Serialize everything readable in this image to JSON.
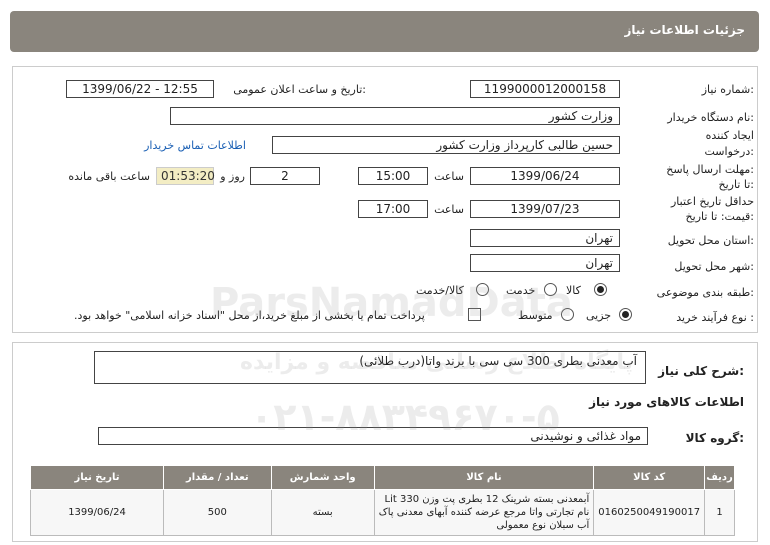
{
  "header": {
    "title": "جزئیات اطلاعات نیاز"
  },
  "form": {
    "need_number_label": "شماره نیاز:",
    "need_number": "1199000012000158",
    "announce_label": "تاریخ و ساعت اعلان عمومی:",
    "announce_value": "1399/06/22 - 12:55",
    "buyer_label": "نام دستگاه خریدار:",
    "buyer_value": "وزارت کشور",
    "requester_label_1": "ایجاد کننده",
    "requester_label_2": "درخواست:",
    "requester_value": "حسین طالبی کارپرداز وزارت کشور",
    "contact_link": "اطلاعات تماس خریدار",
    "deadline_label_1": "مهلت ارسال پاسخ:",
    "deadline_label_2": "تا تاریخ:",
    "deadline_date": "1399/06/24",
    "time_label": "ساعت",
    "deadline_time": "15:00",
    "days_value": "2",
    "days_label": "روز و",
    "remaining_time": "01:53:20",
    "remaining_label": "ساعت باقی مانده",
    "validity_label_1": "حداقل تاریخ اعتبار",
    "validity_label_2": "قیمت: تا تاریخ:",
    "validity_date": "1399/07/23",
    "validity_time_label": "ساعت",
    "validity_time": "17:00",
    "province_label": "استان محل تحویل:",
    "province_value": "تهران",
    "city_label": "شهر محل تحویل:",
    "city_value": "تهران",
    "category_label": "طبقه بندی موضوعی:",
    "category_options": [
      "کالا",
      "خدمت",
      "کالا/خدمت"
    ],
    "category_selected": "کالا",
    "process_label": "نوع فرآیند خرید :",
    "process_options": [
      "جزیی",
      "متوسط"
    ],
    "process_selected": "جزیی",
    "payment_note": "پرداخت تمام یا بخشی از مبلغ خرید،از محل \"اسناد خزانه اسلامی\" خواهد بود."
  },
  "summary": {
    "label": "شرح کلی نیاز:",
    "value": "آب معدنی بطری 300 سی سی با برند واتا(درب طلائی)"
  },
  "goods": {
    "section_title": "اطلاعات کالاهای مورد نیاز",
    "group_label": "گروه کالا:",
    "group_value": "مواد غذائی و نوشیدنی",
    "columns": [
      "ردیف",
      "کد کالا",
      "نام کالا",
      "واحد شمارش",
      "تعداد / مقدار",
      "تاریخ نیاز"
    ],
    "rows": [
      {
        "index": "1",
        "code": "0160250049190017",
        "name": "آبمعدنی بسته شرینک 12 بطری پت وزن Lit 330 نام تجارتی واتا مرجع عرضه کننده آبهای معدنی پاک آب سبلان نوع معمولی",
        "unit": "بسته",
        "qty": "500",
        "date": "1399/06/24"
      }
    ]
  },
  "watermark": {
    "line1": "ParsNamadData",
    "line2": "پایگاه اطلاع رسانی مناقصه و مزایده",
    "line3": "۰۲۱-۸۸۳۴۹۶۷۰-۵"
  }
}
